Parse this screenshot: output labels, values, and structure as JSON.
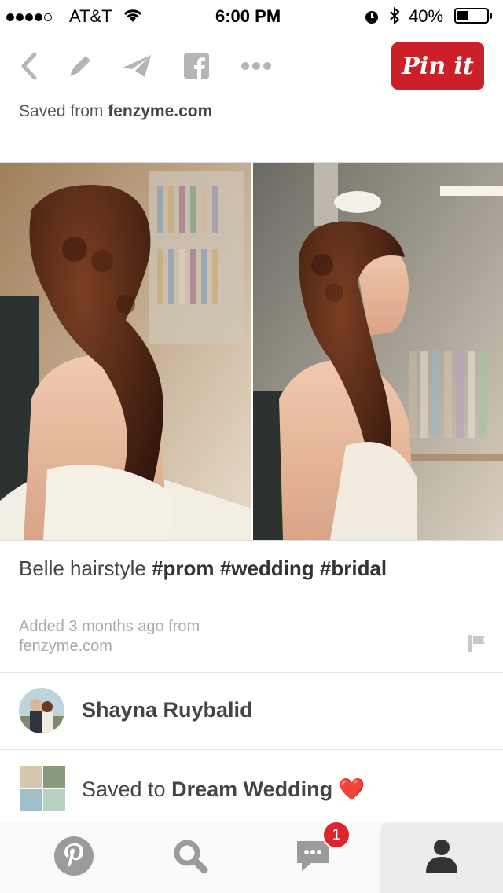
{
  "status_bar": {
    "carrier": "AT&T",
    "time": "6:00 PM",
    "battery": "40%",
    "battery_level": 0.4,
    "signal_bars": 4,
    "signal_max": 5
  },
  "toolbar": {
    "icons": [
      "back-chevron-icon",
      "edit-pencil-icon",
      "send-icon",
      "facebook-icon",
      "more-dots-icon"
    ],
    "pin_it_label": "Pin it",
    "pin_it_color": "#cb2027"
  },
  "saved_from": {
    "prefix": "Saved from",
    "domain": "fenzyme.com"
  },
  "pin": {
    "description_text": "Belle hairstyle",
    "hashtags": "#prom #wedding #bridal",
    "added_line1": "Added 3 months ago from",
    "added_line2": "fenzyme.com"
  },
  "pinner": {
    "name": "Shayna Ruybalid"
  },
  "board": {
    "prefix": "Saved to",
    "name": "Dream Wedding",
    "emoji": "❤️"
  },
  "tabbar": {
    "tabs": [
      "home-pinterest-icon",
      "search-icon",
      "messages-icon",
      "profile-icon"
    ],
    "notification_count": "1",
    "badge_color": "#e0242e"
  }
}
